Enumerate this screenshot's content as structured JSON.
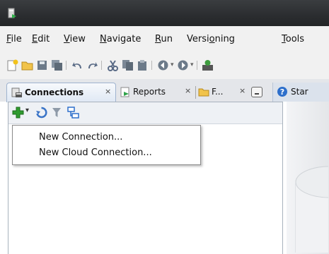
{
  "menu": {
    "items": [
      {
        "mnemonic": "F",
        "rest": "ile"
      },
      {
        "mnemonic": "E",
        "rest": "dit"
      },
      {
        "mnemonic": "V",
        "rest": "iew"
      },
      {
        "mnemonic": "N",
        "rest": "avigate"
      },
      {
        "mnemonic": "R",
        "rest": "un"
      },
      {
        "pre": "Versi",
        "mnemonic": "o",
        "rest": "ning"
      },
      {
        "mnemonic": "T",
        "rest": "ools"
      }
    ]
  },
  "tabs": [
    {
      "label": "Connections",
      "close": "×"
    },
    {
      "label": "Reports",
      "close": "×"
    },
    {
      "label": "F...",
      "close": "×"
    },
    {
      "label": "Star"
    }
  ],
  "dropdown": {
    "items": [
      "New Connection...",
      "New Cloud Connection..."
    ]
  },
  "colors": {
    "accent_green": "#2f9b2f",
    "tab_border": "#9fb3cf"
  }
}
